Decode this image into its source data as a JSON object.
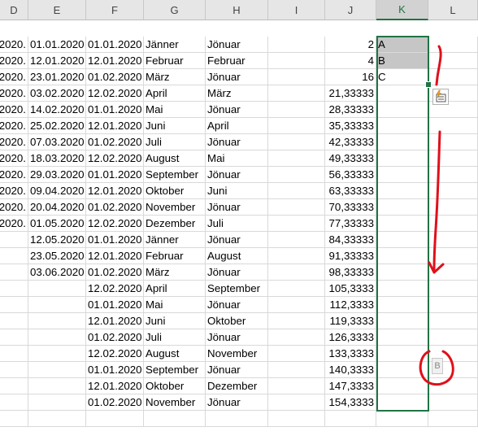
{
  "columns": [
    "D",
    "E",
    "F",
    "G",
    "H",
    "I",
    "J",
    "K",
    "L"
  ],
  "selected_column": "K",
  "rows": [
    {
      "D": ".2020",
      "E": "01.01.2020",
      "F": "01.01.2020",
      "G": "Jänner",
      "H": "Jönuar",
      "I": "",
      "J": "2",
      "K": "A"
    },
    {
      "D": ".2020",
      "E": "12.01.2020",
      "F": "12.01.2020",
      "G": "Februar",
      "H": "Februar",
      "I": "",
      "J": "4",
      "K": "B"
    },
    {
      "D": ".2020",
      "E": "23.01.2020",
      "F": "01.02.2020",
      "G": "März",
      "H": "Jönuar",
      "I": "",
      "J": "16",
      "K": "C"
    },
    {
      "D": ".2020",
      "E": "03.02.2020",
      "F": "12.02.2020",
      "G": "April",
      "H": "März",
      "I": "",
      "J": "21,33333",
      "K": ""
    },
    {
      "D": ".2020",
      "E": "14.02.2020",
      "F": "01.01.2020",
      "G": "Mai",
      "H": "Jönuar",
      "I": "",
      "J": "28,33333",
      "K": ""
    },
    {
      "D": ".2020",
      "E": "25.02.2020",
      "F": "12.01.2020",
      "G": "Juni",
      "H": "April",
      "I": "",
      "J": "35,33333",
      "K": ""
    },
    {
      "D": ".2020",
      "E": "07.03.2020",
      "F": "01.02.2020",
      "G": "Juli",
      "H": "Jönuar",
      "I": "",
      "J": "42,33333",
      "K": ""
    },
    {
      "D": ".2020",
      "E": "18.03.2020",
      "F": "12.02.2020",
      "G": "August",
      "H": "Mai",
      "I": "",
      "J": "49,33333",
      "K": ""
    },
    {
      "D": ".2020",
      "E": "29.03.2020",
      "F": "01.01.2020",
      "G": "September",
      "H": "Jönuar",
      "I": "",
      "J": "56,33333",
      "K": ""
    },
    {
      "D": ".2020",
      "E": "09.04.2020",
      "F": "12.01.2020",
      "G": "Oktober",
      "H": "Juni",
      "I": "",
      "J": "63,33333",
      "K": ""
    },
    {
      "D": ".2020",
      "E": "20.04.2020",
      "F": "01.02.2020",
      "G": "November",
      "H": "Jönuar",
      "I": "",
      "J": "70,33333",
      "K": ""
    },
    {
      "D": ".2020",
      "E": "01.05.2020",
      "F": "12.02.2020",
      "G": "Dezember",
      "H": "Juli",
      "I": "",
      "J": "77,33333",
      "K": ""
    },
    {
      "D": "",
      "E": "12.05.2020",
      "F": "01.01.2020",
      "G": "Jänner",
      "H": "Jönuar",
      "I": "",
      "J": "84,33333",
      "K": ""
    },
    {
      "D": "",
      "E": "23.05.2020",
      "F": "12.01.2020",
      "G": "Februar",
      "H": "August",
      "I": "",
      "J": "91,33333",
      "K": ""
    },
    {
      "D": "",
      "E": "03.06.2020",
      "F": "01.02.2020",
      "G": "März",
      "H": "Jönuar",
      "I": "",
      "J": "98,33333",
      "K": ""
    },
    {
      "D": "",
      "E": "",
      "F": "12.02.2020",
      "G": "April",
      "H": "September",
      "I": "",
      "J": "105,3333",
      "K": ""
    },
    {
      "D": "",
      "E": "",
      "F": "01.01.2020",
      "G": "Mai",
      "H": "Jönuar",
      "I": "",
      "J": "112,3333",
      "K": ""
    },
    {
      "D": "",
      "E": "",
      "F": "12.01.2020",
      "G": "Juni",
      "H": "Oktober",
      "I": "",
      "J": "119,3333",
      "K": ""
    },
    {
      "D": "",
      "E": "",
      "F": "01.02.2020",
      "G": "Juli",
      "H": "Jönuar",
      "I": "",
      "J": "126,3333",
      "K": ""
    },
    {
      "D": "",
      "E": "",
      "F": "12.02.2020",
      "G": "August",
      "H": "November",
      "I": "",
      "J": "133,3333",
      "K": ""
    },
    {
      "D": "",
      "E": "",
      "F": "01.01.2020",
      "G": "September",
      "H": "Jönuar",
      "I": "",
      "J": "140,3333",
      "K": ""
    },
    {
      "D": "",
      "E": "",
      "F": "12.01.2020",
      "G": "Oktober",
      "H": "Dezember",
      "I": "",
      "J": "147,3333",
      "K": ""
    },
    {
      "D": "",
      "E": "",
      "F": "01.02.2020",
      "G": "November",
      "H": "Jönuar",
      "I": "",
      "J": "154,3333",
      "K": ""
    },
    {
      "D": "",
      "E": "",
      "F": "",
      "G": "",
      "H": "",
      "I": "",
      "J": "",
      "K": ""
    }
  ],
  "shaded_cells": [
    "K2",
    "K3"
  ],
  "icons": {
    "flash_fill_options": "flash-fill-options-icon",
    "flash_fill_badge": "flash-fill-badge-icon"
  },
  "flash_fill_badge_text": "B",
  "colors": {
    "selection": "#217346",
    "ink": "#e0101a",
    "shade": "#c6c6c6"
  }
}
